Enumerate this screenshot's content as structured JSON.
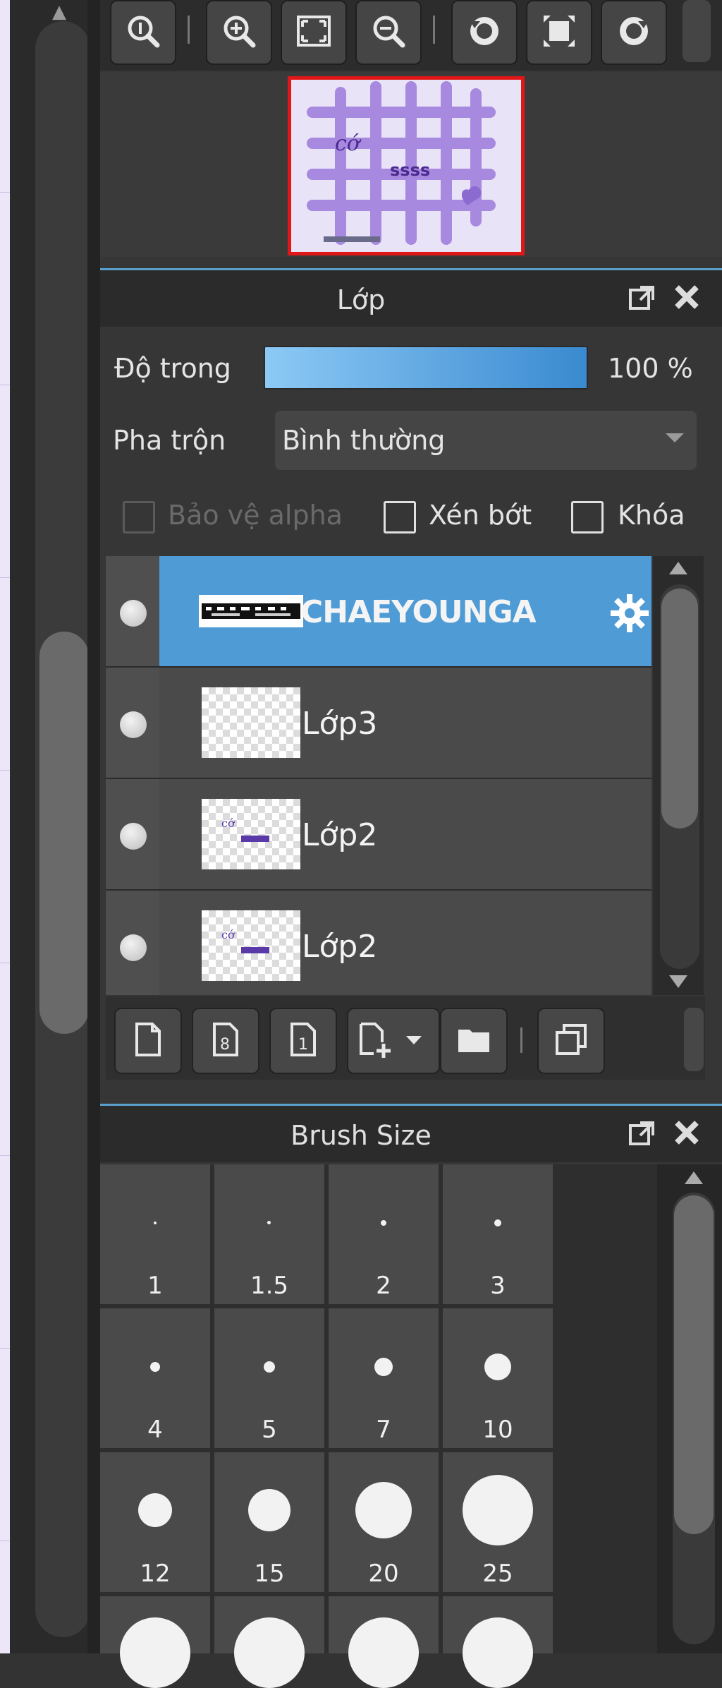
{
  "toolbar": {
    "buttons": [
      {
        "icon": "zoom-actual-icon"
      },
      {
        "icon": "zoom-in-icon"
      },
      {
        "icon": "fit-screen-icon"
      },
      {
        "icon": "zoom-out-icon"
      },
      {
        "icon": "rotate-left-icon"
      },
      {
        "icon": "fullscreen-icon"
      },
      {
        "icon": "rotate-right-icon"
      }
    ]
  },
  "layer_panel": {
    "title": "Lớp",
    "opacity_label": "Độ trong",
    "opacity_value": "100 %",
    "opacity_fraction": 1.0,
    "blend_label": "Pha trộn",
    "blend_value": "Bình thường",
    "protect_alpha_label": "Bảo vệ alpha",
    "clipping_label": "Xén bớt",
    "lock_label": "Khóa",
    "layers": [
      {
        "name": "CHAEYOUNGA",
        "selected": true
      },
      {
        "name": "Lớp3",
        "selected": false
      },
      {
        "name": "Lớp2",
        "selected": false
      },
      {
        "name": "Lớp2",
        "selected": false
      }
    ]
  },
  "brush_panel": {
    "title": "Brush Size",
    "sizes": [
      "1",
      "1.5",
      "2",
      "3",
      "4",
      "5",
      "7",
      "10",
      "12",
      "15",
      "20",
      "25"
    ]
  },
  "colors": {
    "accent": "#4e9bd5",
    "navigator_frame": "#e01717",
    "opacity_bar_start": "#8cc9f5",
    "opacity_bar_end": "#3a8ad0"
  }
}
